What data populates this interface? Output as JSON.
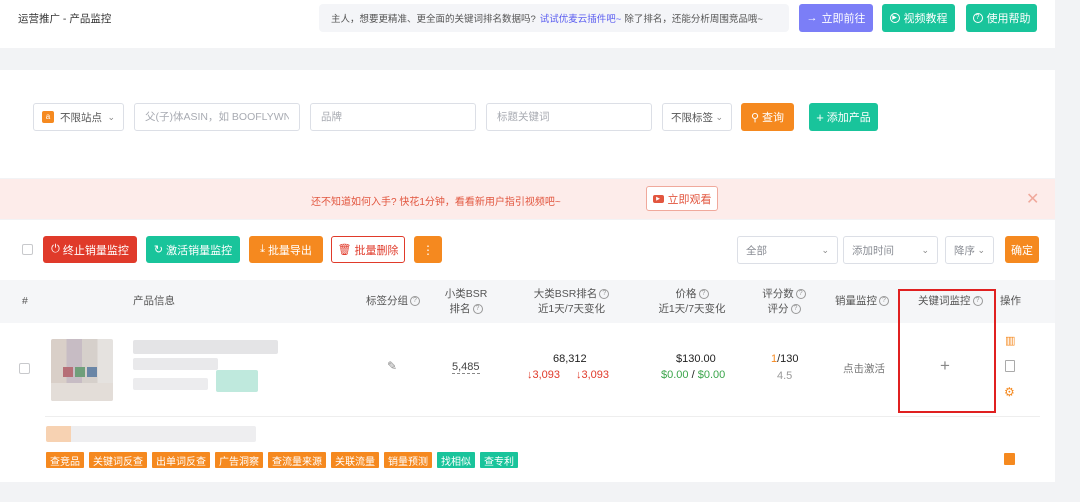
{
  "breadcrumb": "运营推广 - 产品监控",
  "notice": {
    "text_before": "主人，想要更精准、更全面的关键词排名数据吗?",
    "link": "试试优麦云插件吧~",
    "text_after": "除了排名，还能分析周围竞品哦~"
  },
  "header_buttons": {
    "go_now": "立即前往",
    "video_tutorial": "视频教程",
    "help": "使用帮助"
  },
  "filters": {
    "site_label": "不限站点",
    "asin_placeholder": "父(子)体ASIN，如 BOOFLYWNYQ",
    "brand_placeholder": "品牌",
    "keyword_placeholder": "标题关键词",
    "tag_label": "不限标签",
    "search_label": "查询",
    "add_product_label": "添加产品"
  },
  "banner": {
    "text": "还不知道如何入手? 快花1分钟，看看新用户指引视频吧~",
    "watch_label": "立即观看"
  },
  "actions": {
    "stop_monitor": "终止销量监控",
    "activate_monitor": "激活销量监控",
    "bulk_export": "批量导出",
    "bulk_delete": "批量删除",
    "more": "⋮",
    "range_select": "全部",
    "sort_field": "添加时间",
    "sort_order": "降序",
    "confirm": "确定"
  },
  "columns": {
    "index": "#",
    "product_info": "产品信息",
    "tag_group": "标签分组",
    "small_bsr_1": "小类BSR",
    "small_bsr_2": "排名",
    "big_bsr_1": "大类BSR排名",
    "big_bsr_2": "近1天/7天变化",
    "price_1": "价格",
    "price_2": "近1天/7天变化",
    "rating_1": "评分数",
    "rating_2": "评分",
    "sales_monitor": "销量监控",
    "keyword_monitor": "关键词监控",
    "ops": "操作"
  },
  "row": {
    "small_bsr": "5,485",
    "big_bsr": "68,312",
    "big_bsr_day": "↓3,093",
    "big_bsr_week": "↓3,093",
    "price": "$130.00",
    "price_day": "$0.00",
    "price_sep": "/",
    "price_week": "$0.00",
    "rating_count_a": "1",
    "rating_count_b": "/130",
    "rating": "4.5",
    "sales_monitor": "点击激活",
    "keyword_add": "+"
  },
  "quick_tags": [
    "查竞品",
    "关键词反查",
    "出单词反查",
    "广告洞察",
    "查流量来源",
    "关联流量",
    "销量预测",
    "找相似",
    "查专利"
  ],
  "colors": {
    "orange": "#f5891f",
    "green": "#19c49b",
    "purple": "#7b7ef7",
    "red": "#e03a2a",
    "highlight": "#e02020"
  }
}
